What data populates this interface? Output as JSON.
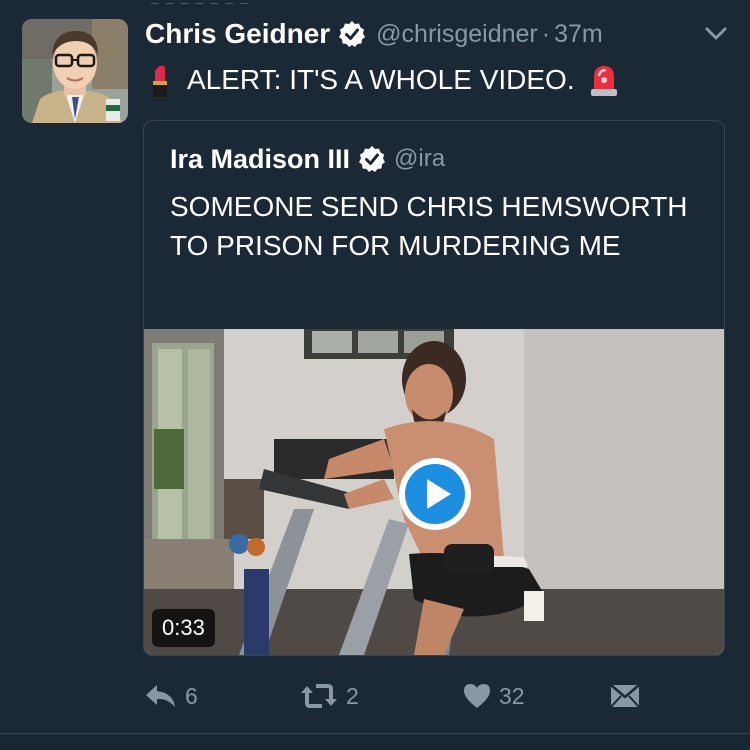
{
  "tweet": {
    "author_name": "Chris Geidner",
    "handle": "@chrisgeidner",
    "separator": "·",
    "time": "37m",
    "text": "ALERT: IT'S A WHOLE VIDEO."
  },
  "quote": {
    "author_name": "Ira Madison III",
    "handle": "@ira",
    "text": "SOMEONE SEND CHRIS HEMSWORTH TO PRISON FOR MURDERING ME",
    "video_duration": "0:33"
  },
  "actions": {
    "reply_count": "6",
    "retweet_count": "2",
    "like_count": "32"
  },
  "icons": {
    "verified": "verified-badge-icon",
    "menu": "chevron-down-icon",
    "emoji_left": "lipstick-emoji-icon",
    "emoji_right": "siren-emoji-icon",
    "play": "play-icon",
    "reply": "reply-icon",
    "retweet": "retweet-icon",
    "like": "heart-icon",
    "dm": "envelope-icon"
  },
  "colors": {
    "background": "#1b2836",
    "secondary_text": "#8899a6",
    "border": "#38444d",
    "play_blue": "#1d8fe0"
  }
}
